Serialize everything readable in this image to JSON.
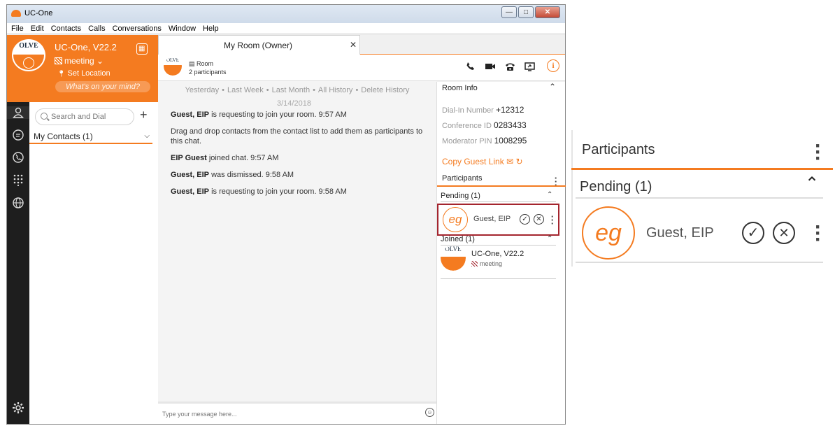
{
  "window": {
    "title": "UC-One",
    "minimize": "—",
    "maximize": "□",
    "close": "✕"
  },
  "menu": [
    "File",
    "Edit",
    "Contacts",
    "Calls",
    "Conversations",
    "Window",
    "Help"
  ],
  "profile": {
    "logo_text": "OLVE",
    "name": "UC-One, V22.2",
    "status": "meeting",
    "location": "Set Location",
    "mind_placeholder": "What's on your mind?"
  },
  "contacts": {
    "search_placeholder": "Search and Dial",
    "group_label": "My Contacts (1)"
  },
  "chat": {
    "tab_label": "My Room (Owner)",
    "room_type": "Room",
    "participants_count": "2 participants",
    "history_links": [
      "Yesterday",
      "Last Week",
      "Last Month",
      "All History",
      "Delete History"
    ],
    "date": "3/14/2018",
    "messages": [
      {
        "name": "Guest, EIP",
        "text": " is requesting to join your room. 9:57 AM"
      },
      {
        "name": "",
        "text": "Drag and drop contacts from the contact list to add them as participants to this chat."
      },
      {
        "name": "EIP Guest",
        "text": " joined chat. 9:57 AM"
      },
      {
        "name": "Guest, EIP",
        "text": " was dismissed. 9:58 AM"
      },
      {
        "name": "Guest, EIP",
        "text": " is requesting to join your room. 9:58 AM"
      }
    ],
    "composer_placeholder": "Type your message here..."
  },
  "room_info": {
    "header": "Room Info",
    "dial_in_label": "Dial-In Number",
    "dial_in_value": "+12312",
    "conference_label": "Conference ID",
    "conference_value": "0283433",
    "moderator_label": "Moderator PIN",
    "moderator_value": "1008295",
    "copy_guest_link": "Copy Guest Link",
    "participants_label": "Participants",
    "pending_label": "Pending (1)",
    "pending_initials": "eg",
    "pending_name": "Guest, EIP",
    "joined_label": "Joined (1)",
    "joined_name": "UC-One, V22.2",
    "joined_status": "meeting"
  },
  "zoom": {
    "participants_label": "Participants",
    "pending_label": "Pending (1)",
    "initials": "eg",
    "name": "Guest, EIP"
  },
  "colors": {
    "accent": "#f47b20",
    "highlight_border": "#a4252e",
    "rail": "#1e1e1e"
  }
}
